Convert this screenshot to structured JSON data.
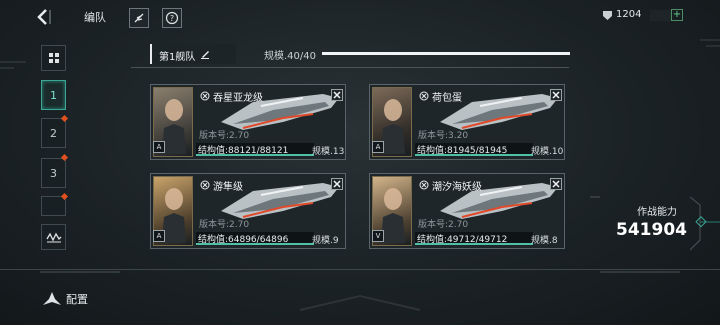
{
  "header": {
    "title": "编队",
    "resource_value": "1204",
    "resource_plus": "+"
  },
  "sidebar": {
    "tabs": [
      {
        "label": "1",
        "active": true,
        "alert": false
      },
      {
        "label": "2",
        "active": false,
        "alert": true
      },
      {
        "label": "3",
        "active": false,
        "alert": true
      },
      {
        "label": "",
        "active": false,
        "alert": true
      }
    ]
  },
  "fleet": {
    "tab_label": "第1舰队",
    "scale_text": "规模.40/40",
    "scale_fill": 1.0
  },
  "ships": [
    {
      "name": "吞星亚龙级",
      "version": "版本号:2.70",
      "hp": "结构值:88121/88121",
      "scale": "规模.13",
      "rank": "A"
    },
    {
      "name": "荷包蛋",
      "version": "版本号:3.20",
      "hp": "结构值:81945/81945",
      "scale": "规模.10",
      "rank": "A"
    },
    {
      "name": "游隼级",
      "version": "版本号:2.70",
      "hp": "结构值:64896/64896",
      "scale": "规模.9",
      "rank": "A"
    },
    {
      "name": "潮汐海妖级",
      "version": "版本号:2.70",
      "hp": "结构值:49712/49712",
      "scale": "规模.8",
      "rank": "V"
    }
  ],
  "power": {
    "label": "作战能力",
    "value": "541904"
  },
  "footer": {
    "config_label": "配置"
  },
  "colors": {
    "accent": "#4fc0a6",
    "alert": "#e0501e",
    "background": "#1b2226"
  }
}
